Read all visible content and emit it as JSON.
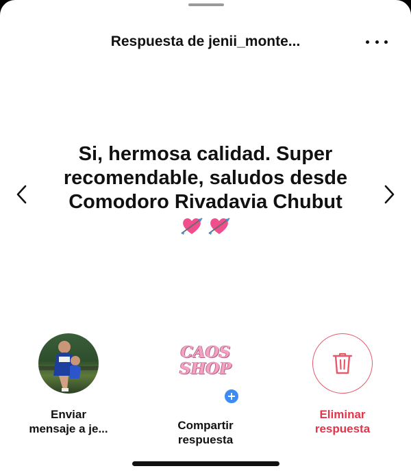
{
  "header": {
    "title": "Respuesta de jenii_monte...",
    "more_icon": "more-horizontal-icon"
  },
  "message": {
    "text": "Si, hermosa calidad. Super recomendable, saludos desde Comodoro Rivadavia Chubut",
    "emojis": [
      "heart-with-arrow-emoji",
      "heart-with-arrow-emoji"
    ]
  },
  "navigation": {
    "prev_icon": "chevron-left-icon",
    "next_icon": "chevron-right-icon"
  },
  "actions": {
    "send_message": {
      "label_line1": "Enviar",
      "label_line2": "mensaje a je..."
    },
    "share_reply": {
      "label_line1": "Compartir",
      "label_line2": "respuesta",
      "logo_line1": "CAOS",
      "logo_line2": "SHOP"
    },
    "delete_reply": {
      "label_line1": "Eliminar",
      "label_line2": "respuesta"
    }
  },
  "colors": {
    "delete": "#e2344a",
    "badge": "#3d8cf5",
    "logo_pink": "#f4a2c2"
  }
}
